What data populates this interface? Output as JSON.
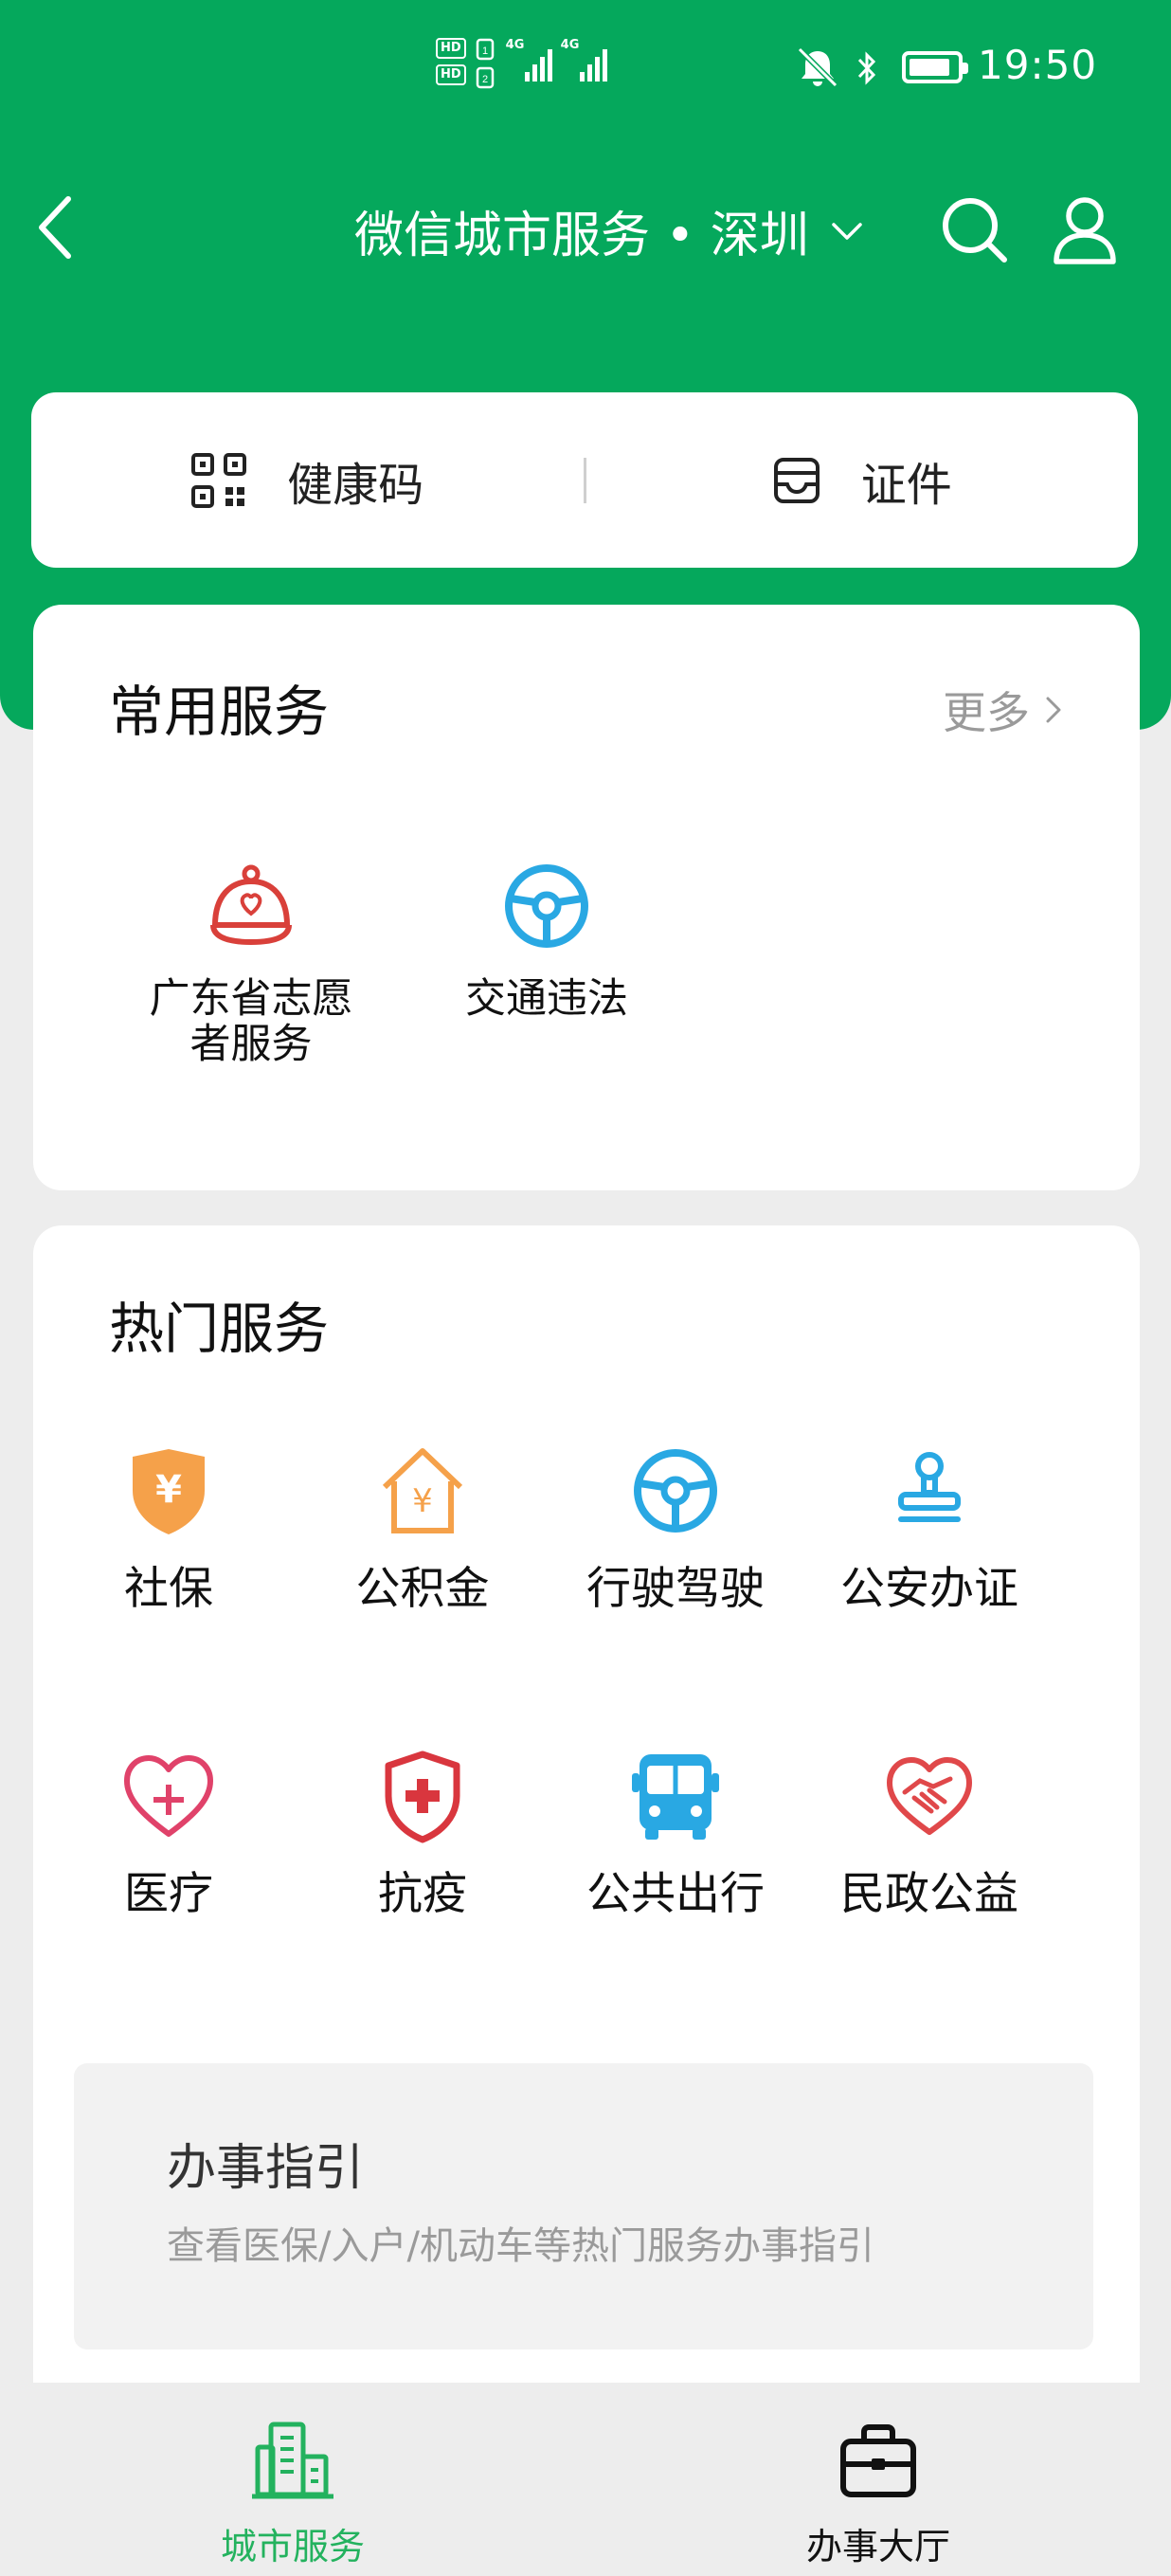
{
  "status_bar": {
    "time": "19:50",
    "sim1_tag": "HD",
    "sim2_tag": "HD",
    "network1": "4G",
    "network2": "4G",
    "icons": [
      "mute-icon",
      "bluetooth-icon",
      "battery-icon"
    ]
  },
  "header": {
    "title": "微信城市服务 • 深圳",
    "back_icon": "back-arrow-icon",
    "search_icon": "search-icon",
    "user_icon": "user-icon",
    "accent_color": "#05a85c"
  },
  "quick": {
    "health_code": "健康码",
    "certificate": "证件"
  },
  "common": {
    "title": "常用服务",
    "more": "更多",
    "items": [
      {
        "label": "广东省志愿\n者服务",
        "icon": "volunteer-cap-icon"
      },
      {
        "label": "交通违法",
        "icon": "steering-wheel-icon"
      }
    ]
  },
  "hot": {
    "title": "热门服务",
    "items": [
      {
        "label": "社保",
        "icon": "social-security-shield-icon"
      },
      {
        "label": "公积金",
        "icon": "housing-fund-icon"
      },
      {
        "label": "行驶驾驶",
        "icon": "steering-wheel-icon"
      },
      {
        "label": "公安办证",
        "icon": "stamp-icon"
      },
      {
        "label": "医疗",
        "icon": "medical-heart-icon"
      },
      {
        "label": "抗疫",
        "icon": "epidemic-shield-icon"
      },
      {
        "label": "公共出行",
        "icon": "bus-icon"
      },
      {
        "label": "民政公益",
        "icon": "handshake-heart-icon"
      }
    ]
  },
  "guide": {
    "title": "办事指引",
    "subtitle": "查看医保/入户/机动车等热门服务办事指引"
  },
  "tabbar": {
    "tabs": [
      {
        "label": "城市服务",
        "active": true
      },
      {
        "label": "办事大厅",
        "active": false
      }
    ]
  }
}
